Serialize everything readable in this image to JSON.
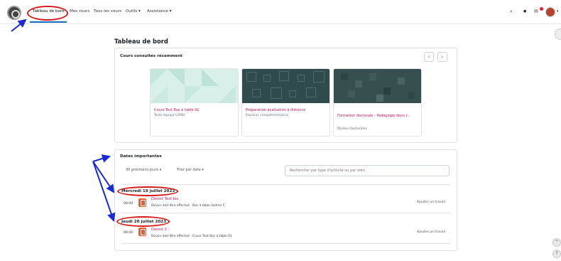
{
  "nav": {
    "items": [
      "Tableau de bord",
      "Mes cours",
      "Tous les cours",
      "Outils",
      "Assistance"
    ],
    "dropdown_caret": "▾"
  },
  "icons": {
    "search": "⌕",
    "bell": "●",
    "chat": "✉"
  },
  "page_title": "Tableau de bord",
  "recent": {
    "title": "Cours consultés récemment",
    "prev": "‹",
    "next": "›",
    "courses": [
      {
        "name": "Cours Test Bac à table 01",
        "category": "Tests équipe CEMU"
      },
      {
        "name": "Préparation évaluation à distance",
        "category": "Espaces complémentaires"
      },
      {
        "name": "Formation doctorale - Pédagogie dans l...",
        "category": "Études Doctorales"
      }
    ]
  },
  "timeline": {
    "title": "Dates importantes",
    "filter_days": "30 prochains jours",
    "sort": "Trier par date",
    "search_placeholder": "Rechercher par type d'activité ou par nom",
    "groups": [
      {
        "date": "Mercredi 19 juillet 2023",
        "time": "00:00",
        "event_title": "Devoir Test bis",
        "event_sub": "Devoir doit être effectué · Bac à table Valérie C.",
        "action": "Ajouter un travail"
      },
      {
        "date": "Jeudi 20 juillet 2023",
        "time": "00:00",
        "event_title": "Devoir 3",
        "event_sub": "Devoir doit être effectué · Cours Test Bac à table 01",
        "action": "Ajouter un travail"
      }
    ]
  },
  "float_buttons": [
    "^",
    "?"
  ],
  "colors": {
    "accent": "#c2185b",
    "annotation_ellipse": "#d51a1a",
    "annotation_arrow": "#1a2bd6",
    "pdf_icon": "#ee5a2c"
  }
}
